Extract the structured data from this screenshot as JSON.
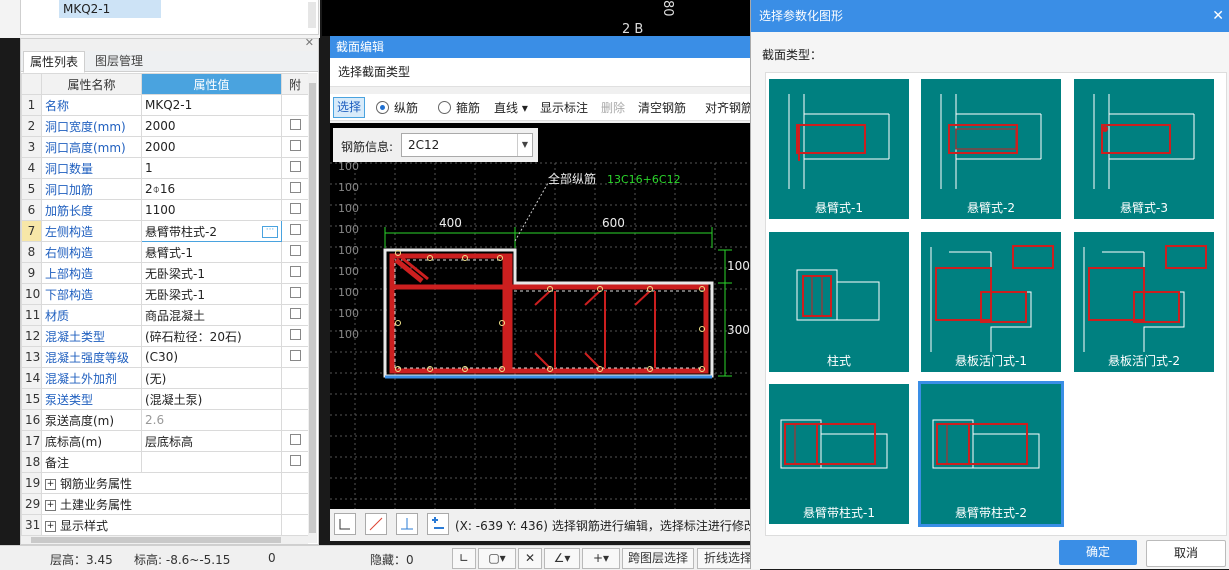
{
  "top_list": {
    "selected": "MKQ2-1"
  },
  "props": {
    "tab_active": "属性列表",
    "tab_inactive": "图层管理",
    "col_name": "属性名称",
    "col_value": "属性值",
    "col_extra": "附",
    "rows": [
      {
        "n": "1",
        "name": "名称",
        "value": "MKQ2-1",
        "chk": false,
        "blue": true
      },
      {
        "n": "2",
        "name": "洞口宽度(mm)",
        "value": "2000",
        "chk": true,
        "blue": true
      },
      {
        "n": "3",
        "name": "洞口高度(mm)",
        "value": "2000",
        "chk": true,
        "blue": true
      },
      {
        "n": "4",
        "name": "洞口数量",
        "value": "1",
        "chk": true,
        "blue": true
      },
      {
        "n": "5",
        "name": "洞口加筋",
        "value": "2⌽16",
        "chk": true,
        "blue": true
      },
      {
        "n": "6",
        "name": "加筋长度",
        "value": "1100",
        "chk": true,
        "blue": true
      },
      {
        "n": "7",
        "name": "左侧构造",
        "value": "悬臂带柱式-2",
        "chk": true,
        "blue": true
      },
      {
        "n": "8",
        "name": "右侧构造",
        "value": "悬臂式-1",
        "chk": true,
        "blue": true
      },
      {
        "n": "9",
        "name": "上部构造",
        "value": "无卧梁式-1",
        "chk": true,
        "blue": true
      },
      {
        "n": "10",
        "name": "下部构造",
        "value": "无卧梁式-1",
        "chk": true,
        "blue": true
      },
      {
        "n": "11",
        "name": "材质",
        "value": "商品混凝土",
        "chk": true,
        "blue": true
      },
      {
        "n": "12",
        "name": "混凝土类型",
        "value": "(碎石粒径：20石)",
        "chk": true,
        "blue": true
      },
      {
        "n": "13",
        "name": "混凝土强度等级",
        "value": "(C30)",
        "chk": true,
        "blue": true
      },
      {
        "n": "14",
        "name": "混凝土外加剂",
        "value": "(无)",
        "chk": false,
        "blue": true
      },
      {
        "n": "15",
        "name": "泵送类型",
        "value": "(混凝土泵)",
        "chk": false,
        "blue": true
      },
      {
        "n": "16",
        "name": "泵送高度(m)",
        "value": "2.6",
        "chk": false,
        "blue": false,
        "gray": true
      },
      {
        "n": "17",
        "name": "底标高(m)",
        "value": "层底标高",
        "chk": true,
        "blue": false
      },
      {
        "n": "18",
        "name": "备注",
        "value": "",
        "chk": true,
        "blue": false
      },
      {
        "n": "19",
        "name": "钢筋业务属性",
        "value": "",
        "group": true
      },
      {
        "n": "29",
        "name": "土建业务属性",
        "value": "",
        "group": true
      },
      {
        "n": "31",
        "name": "显示样式",
        "value": "",
        "group": true
      }
    ]
  },
  "status": {
    "floor_height": "层高：3.45",
    "elevation": "标高: -8.6~-5.15",
    "zero": "0",
    "hidden": "隐藏：0",
    "cross_layer": "跨图层选择",
    "polyline": "折线选择"
  },
  "cad_top": {
    "dim1": "80",
    "dim2": "2 B"
  },
  "section_dialog": {
    "title": "截面编辑",
    "select_type": "选择截面类型",
    "tool_select": "选择",
    "radio_long": "纵筋",
    "radio_stirrup": "箍筋",
    "tool_line": "直线",
    "tool_show_label": "显示标注",
    "tool_delete": "删除",
    "tool_clear": "清空钢筋",
    "tool_align": "对齐钢筋",
    "rebar_info_label": "钢筋信息:",
    "rebar_info_value": "2C12",
    "annot_all": "全部纵筋",
    "annot_value": "13C16+6C12",
    "dim_400": "400",
    "dim_600": "600",
    "dim_100": "100",
    "dim_300": "300",
    "grid_label": "100",
    "coord": "(X: -639 Y: 436)",
    "hint": "选择钢筋进行编辑，选择标注进行修改"
  },
  "picker": {
    "title": "选择参数化图形",
    "section_label": "截面类型：",
    "items": [
      "悬臂式-1",
      "悬臂式-2",
      "悬臂式-3",
      "柱式",
      "悬板活门式-1",
      "悬板活门式-2",
      "悬臂带柱式-1",
      "悬臂带柱式-2"
    ],
    "ok": "确定",
    "cancel": "取消"
  },
  "colors": {
    "accent": "#3a8ee6",
    "teal": "#008080",
    "rebar": "#cc1f1f"
  }
}
